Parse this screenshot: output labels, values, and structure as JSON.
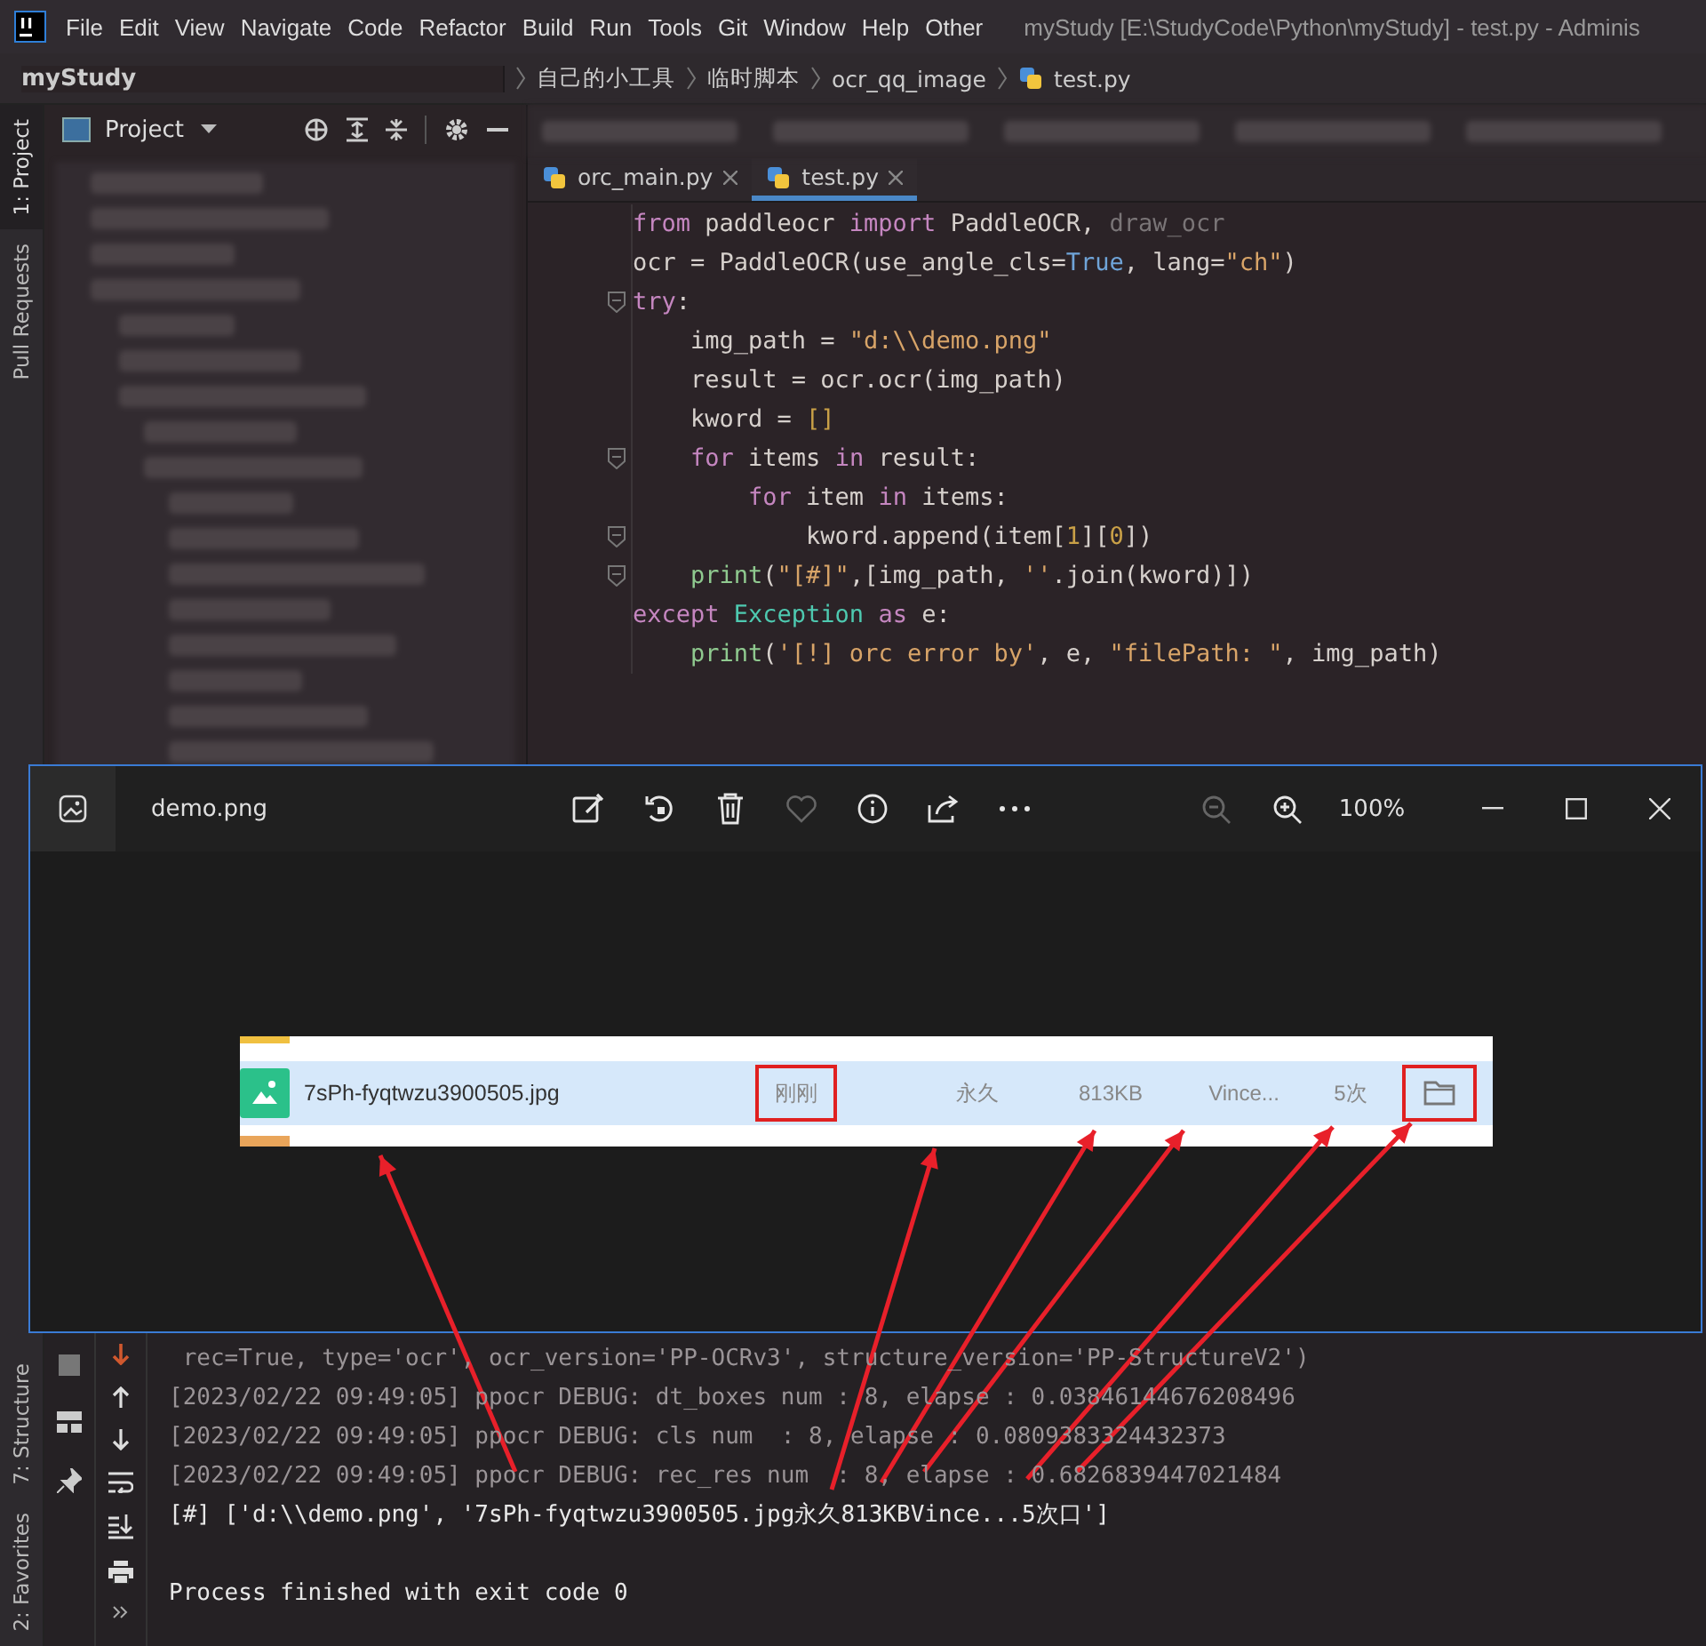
{
  "menu_bar": {
    "items": [
      "File",
      "Edit",
      "View",
      "Navigate",
      "Code",
      "Refactor",
      "Build",
      "Run",
      "Tools",
      "Git",
      "Window",
      "Help",
      "Other"
    ],
    "title": "myStudy [E:\\StudyCode\\Python\\myStudy] - test.py - Adminis"
  },
  "breadcrumb": [
    {
      "label": "myStudy",
      "kind": "project"
    },
    {
      "label": "自己的小工具",
      "kind": "folder"
    },
    {
      "label": "临时脚本",
      "kind": "folder"
    },
    {
      "label": "ocr_qq_image",
      "kind": "folder"
    },
    {
      "label": "test.py",
      "kind": "file"
    }
  ],
  "side_tabs": [
    {
      "label": "1: Project",
      "selected": true
    },
    {
      "label": "Pull Requests",
      "selected": false
    }
  ],
  "bottom_side_tabs": [
    {
      "label": "7: Structure",
      "selected": false
    },
    {
      "label": "2: Favorites",
      "selected": false
    }
  ],
  "project_panel": {
    "title": "Project"
  },
  "editor": {
    "tabs": [
      {
        "label": "orc_main.py",
        "selected": false
      },
      {
        "label": "test.py",
        "selected": true
      }
    ],
    "lines": [
      {
        "fold": false,
        "tokens": [
          {
            "kind": "kw",
            "text": "from"
          },
          {
            "kind": "plain",
            "text": " paddleocr "
          },
          {
            "kind": "kw",
            "text": "import"
          },
          {
            "kind": "plain",
            "text": " PaddleOCR, "
          },
          {
            "kind": "dim",
            "text": "draw_ocr"
          }
        ]
      },
      {
        "fold": false,
        "tokens": [
          {
            "kind": "plain",
            "text": "ocr = PaddleOCR(use_angle_cls="
          },
          {
            "kind": "const",
            "text": "True"
          },
          {
            "kind": "plain",
            "text": ", lang="
          },
          {
            "kind": "str",
            "text": "\"ch\""
          },
          {
            "kind": "plain",
            "text": ")"
          }
        ]
      },
      {
        "fold": true,
        "tokens": [
          {
            "kind": "kw",
            "text": "try"
          },
          {
            "kind": "plain",
            "text": ":"
          }
        ]
      },
      {
        "fold": false,
        "tokens": [
          {
            "kind": "plain",
            "text": "    img_path = "
          },
          {
            "kind": "str",
            "text": "\"d:\\\\demo.png\""
          }
        ]
      },
      {
        "fold": false,
        "tokens": [
          {
            "kind": "plain",
            "text": "    result = ocr.ocr(img_path)"
          }
        ]
      },
      {
        "fold": false,
        "tokens": [
          {
            "kind": "plain",
            "text": "    kword = "
          },
          {
            "kind": "num",
            "text": "[]"
          }
        ]
      },
      {
        "fold": true,
        "tokens": [
          {
            "kind": "kw",
            "text": "    for"
          },
          {
            "kind": "plain",
            "text": " items "
          },
          {
            "kind": "kw",
            "text": "in"
          },
          {
            "kind": "plain",
            "text": " result:"
          }
        ]
      },
      {
        "fold": false,
        "tokens": [
          {
            "kind": "kw",
            "text": "        for"
          },
          {
            "kind": "plain",
            "text": " item "
          },
          {
            "kind": "kw",
            "text": "in"
          },
          {
            "kind": "plain",
            "text": " items:"
          }
        ]
      },
      {
        "fold": true,
        "tokens": [
          {
            "kind": "plain",
            "text": "            kword.append(item["
          },
          {
            "kind": "num",
            "text": "1"
          },
          {
            "kind": "plain",
            "text": "]["
          },
          {
            "kind": "num",
            "text": "0"
          },
          {
            "kind": "plain",
            "text": "])"
          }
        ]
      },
      {
        "fold": true,
        "tokens": [
          {
            "kind": "builtin",
            "text": "    print"
          },
          {
            "kind": "plain",
            "text": "("
          },
          {
            "kind": "str",
            "text": "\"[#]\""
          },
          {
            "kind": "plain",
            "text": ",[img_path, "
          },
          {
            "kind": "str",
            "text": "''"
          },
          {
            "kind": "plain",
            "text": ".join(kword)])"
          }
        ]
      },
      {
        "fold": false,
        "tokens": [
          {
            "kind": "kw",
            "text": "except "
          },
          {
            "kind": "cls",
            "text": "Exception "
          },
          {
            "kind": "kw",
            "text": "as"
          },
          {
            "kind": "plain",
            "text": " e:"
          }
        ]
      },
      {
        "fold": false,
        "tokens": [
          {
            "kind": "builtin",
            "text": "    print"
          },
          {
            "kind": "plain",
            "text": "("
          },
          {
            "kind": "str",
            "text": "'[!] orc error by'"
          },
          {
            "kind": "plain",
            "text": ", e, "
          },
          {
            "kind": "str",
            "text": "\"filePath: \""
          },
          {
            "kind": "plain",
            "text": ", img_path)"
          }
        ]
      }
    ]
  },
  "console": {
    "lines": [
      {
        "kind": "log",
        "text": " rec=True, type='ocr', ocr_version='PP-OCRv3', structure_version='PP-StructureV2')"
      },
      {
        "kind": "log",
        "text": "[2023/02/22 09:49:05] ppocr DEBUG: dt_boxes num : 8, elapse : 0.03846144676208496"
      },
      {
        "kind": "log",
        "text": "[2023/02/22 09:49:05] ppocr DEBUG: cls num  : 8, elapse : 0.0809383324432373"
      },
      {
        "kind": "log",
        "text": "[2023/02/22 09:49:05] ppocr DEBUG: rec_res num  : 8, elapse : 0.6826839447021484"
      },
      {
        "kind": "output",
        "text": "[#] ['d:\\\\demo.png', '7sPh-fyqtwzu3900505.jpg永久813KBVince...5次口']"
      },
      {
        "kind": "exit",
        "text": "Process finished with exit code 0"
      }
    ]
  },
  "viewer": {
    "title": "demo.png",
    "zoom": "100%",
    "tools": [
      {
        "kind": "edit",
        "disabled": false
      },
      {
        "kind": "rotate",
        "disabled": false
      },
      {
        "kind": "delete",
        "disabled": false
      },
      {
        "kind": "favorite",
        "disabled": true
      },
      {
        "kind": "info",
        "disabled": false
      },
      {
        "kind": "share",
        "disabled": false
      },
      {
        "kind": "more",
        "disabled": false
      }
    ],
    "zoom_tools": [
      {
        "kind": "zoom-out",
        "disabled": true
      },
      {
        "kind": "zoom-in",
        "disabled": false
      }
    ],
    "image": {
      "file_name": "7sPh-fyqtwzu3900505.jpg",
      "folder_highlighted": true,
      "cells": [
        {
          "text": "刚刚",
          "highlighted": true
        },
        {
          "text": "永久",
          "highlighted": false
        },
        {
          "text": "813KB",
          "highlighted": false
        },
        {
          "text": "Vince...",
          "highlighted": false
        },
        {
          "text": "5次",
          "highlighted": false
        }
      ]
    }
  }
}
